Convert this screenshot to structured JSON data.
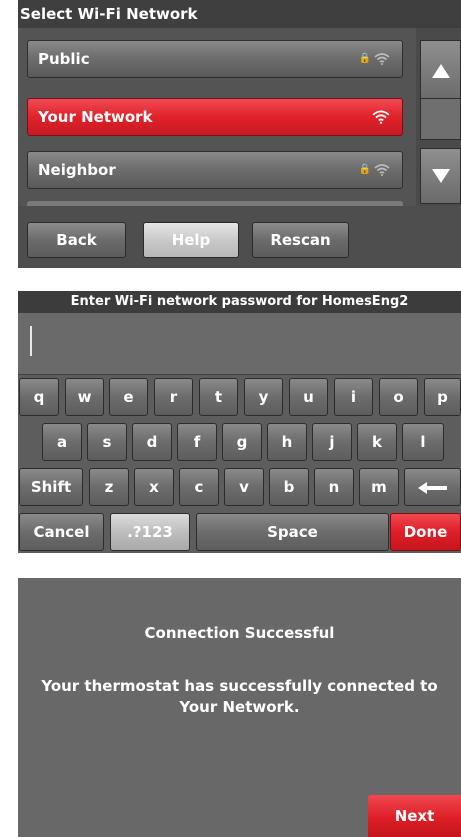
{
  "screen1": {
    "title": "Select Wi-Fi Network",
    "networks": [
      {
        "name": "Public",
        "secured": true,
        "selected": false
      },
      {
        "name": "Your Network",
        "secured": false,
        "selected": true
      },
      {
        "name": "Neighbor",
        "secured": true,
        "selected": false
      }
    ],
    "buttons": {
      "back": "Back",
      "help": "Help",
      "rescan": "Rescan"
    }
  },
  "screen2": {
    "title": "Enter Wi-Fi network password for HomesEng2",
    "password_value": "",
    "rows": [
      [
        "q",
        "w",
        "e",
        "r",
        "t",
        "y",
        "u",
        "i",
        "o",
        "p"
      ],
      [
        "a",
        "s",
        "d",
        "f",
        "g",
        "h",
        "j",
        "k",
        "l"
      ],
      [
        "Shift",
        "z",
        "x",
        "c",
        "v",
        "b",
        "n",
        "m"
      ]
    ],
    "bottom": {
      "cancel": "Cancel",
      "symbols": ".?123",
      "space": "Space",
      "done": "Done"
    }
  },
  "screen3": {
    "title": "Connection Successful",
    "message_line1": "Your thermostat has successfully connected to",
    "message_line2": "Your Network.",
    "next": "Next"
  },
  "colors": {
    "accent_red": "#e0222b",
    "panel_gray": "#5d5d5d",
    "title_bar": "#3f3f3f"
  }
}
